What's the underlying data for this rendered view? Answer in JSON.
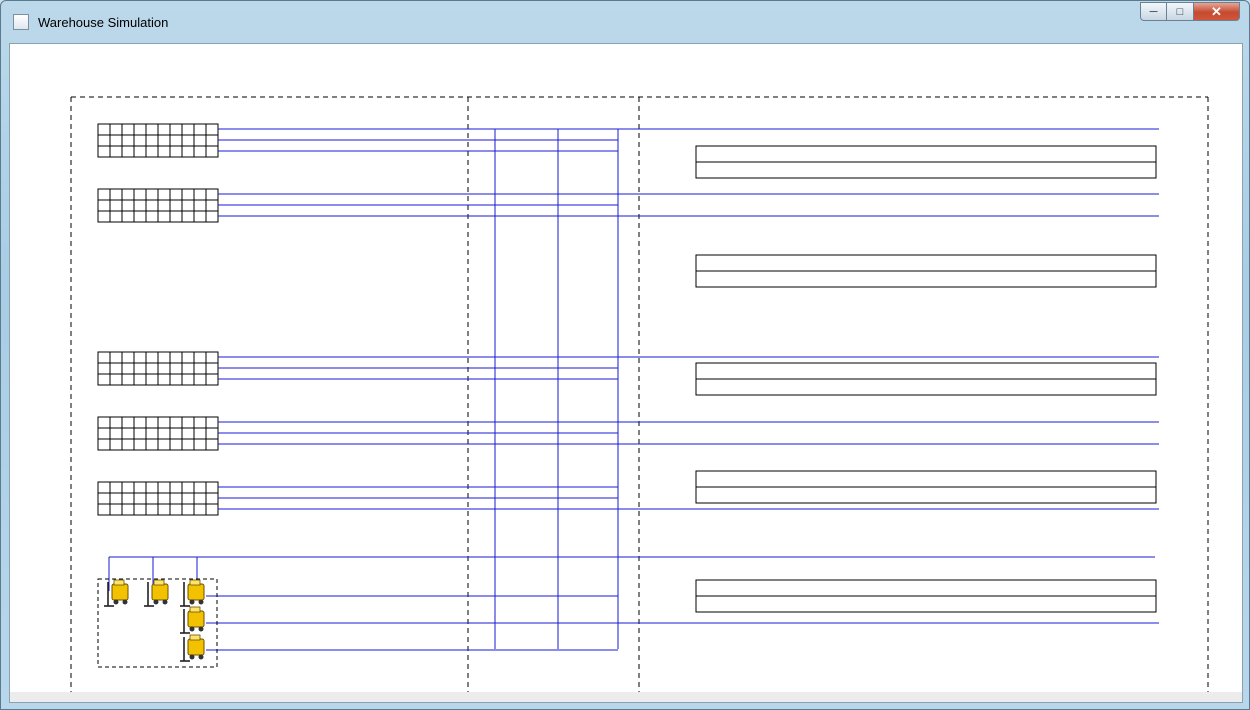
{
  "window": {
    "title": "Warehouse Simulation",
    "icons": {
      "app": "java-app-icon",
      "minimize": "minimize-icon",
      "maximize": "maximize-icon",
      "close": "close-icon",
      "forklift": "forklift-icon"
    }
  },
  "colors": {
    "track": "#1a1ad6",
    "outline": "#000000",
    "zone_border": "#000000",
    "forklift": "#f2c200"
  },
  "simulation": {
    "zones": [
      "storage-zone",
      "transfer-zone",
      "dock-zone"
    ],
    "racks": 5,
    "rack_columns": 10,
    "rack_rows": 3,
    "docks": 5,
    "forklifts": 5
  }
}
